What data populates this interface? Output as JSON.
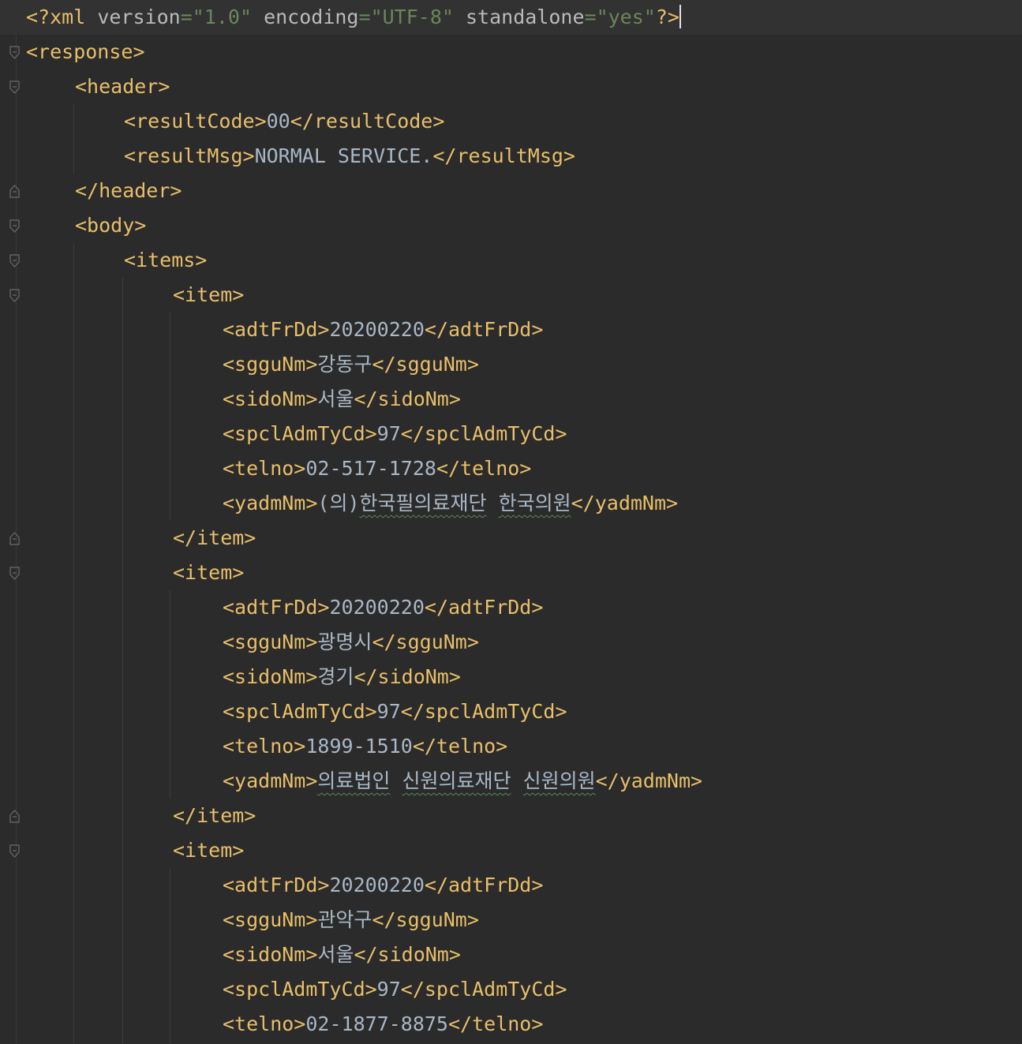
{
  "editor": {
    "colors": {
      "background": "#2b2b2b",
      "tag": "#e8bf6a",
      "attribute": "#bababa",
      "attribute_value": "#6a8759",
      "text": "#a9b7c6",
      "current_line": "#323232"
    },
    "declaration": {
      "open": "<?xml",
      "version_attr": "version",
      "version_value": "\"1.0\"",
      "encoding_attr": "encoding",
      "encoding_value": "\"UTF-8\"",
      "standalone_attr": "standalone",
      "standalone_value": "\"yes\"",
      "close": "?>"
    },
    "response_open": "<response>",
    "header_open": "<header>",
    "result_code": {
      "open": "<resultCode>",
      "value": "00",
      "close": "</resultCode>"
    },
    "result_msg": {
      "open": "<resultMsg>",
      "value": "NORMAL SERVICE.",
      "close": "</resultMsg>"
    },
    "header_close": "</header>",
    "body_open": "<body>",
    "items_open": "<items>",
    "item_open": "<item>",
    "item_close": "</item>",
    "items": [
      {
        "adtFrDd": {
          "open": "<adtFrDd>",
          "value": "20200220",
          "close": "</adtFrDd>"
        },
        "sgguNm": {
          "open": "<sgguNm>",
          "value": "강동구",
          "close": "</sgguNm>"
        },
        "sidoNm": {
          "open": "<sidoNm>",
          "value": "서울",
          "close": "</sidoNm>"
        },
        "spclAdmTyCd": {
          "open": "<spclAdmTyCd>",
          "value": "97",
          "close": "</spclAdmTyCd>"
        },
        "telno": {
          "open": "<telno>",
          "value": "02-517-1728",
          "close": "</telno>"
        },
        "yadmNm": {
          "open": "<yadmNm>",
          "prefix": "(의)",
          "words": [
            "한국필의료재단",
            "한국의원"
          ],
          "close": "</yadmNm>"
        }
      },
      {
        "adtFrDd": {
          "open": "<adtFrDd>",
          "value": "20200220",
          "close": "</adtFrDd>"
        },
        "sgguNm": {
          "open": "<sgguNm>",
          "value": "광명시",
          "close": "</sgguNm>"
        },
        "sidoNm": {
          "open": "<sidoNm>",
          "value": "경기",
          "close": "</sidoNm>"
        },
        "spclAdmTyCd": {
          "open": "<spclAdmTyCd>",
          "value": "97",
          "close": "</spclAdmTyCd>"
        },
        "telno": {
          "open": "<telno>",
          "value": "1899-1510",
          "close": "</telno>"
        },
        "yadmNm": {
          "open": "<yadmNm>",
          "prefix": "",
          "words": [
            "의료법인",
            "신원의료재단",
            "신원의원"
          ],
          "close": "</yadmNm>"
        }
      },
      {
        "adtFrDd": {
          "open": "<adtFrDd>",
          "value": "20200220",
          "close": "</adtFrDd>"
        },
        "sgguNm": {
          "open": "<sgguNm>",
          "value": "관악구",
          "close": "</sgguNm>"
        },
        "sidoNm": {
          "open": "<sidoNm>",
          "value": "서울",
          "close": "</sidoNm>"
        },
        "spclAdmTyCd": {
          "open": "<spclAdmTyCd>",
          "value": "97",
          "close": "</spclAdmTyCd>"
        },
        "telno": {
          "open": "<telno>",
          "value": "02-1877-8875",
          "close": "</telno>"
        }
      }
    ]
  }
}
